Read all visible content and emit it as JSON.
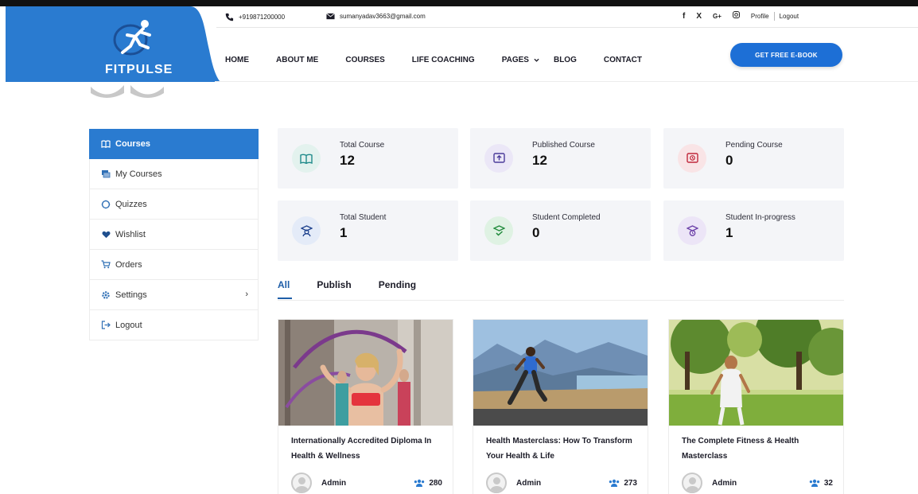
{
  "brand": {
    "name": "FITPULSE",
    "panel_color": "#2a7bd0"
  },
  "contact": {
    "phone": "+919871200000",
    "email": "sumanyadav3663@gmail.com"
  },
  "social": {
    "facebook": "f",
    "x": "X",
    "google": "G+",
    "profile": "Profile",
    "logout": "Logout"
  },
  "nav": {
    "items": [
      "HOME",
      "ABOUT ME",
      "COURSES",
      "LIFE COACHING",
      "PAGES",
      "BLOG",
      "CONTACT"
    ],
    "cta": "GET FREE E-BOOK"
  },
  "sidebar": {
    "items": [
      {
        "label": "Courses",
        "icon": "book-open-icon"
      },
      {
        "label": "My Courses",
        "icon": "courses-stack-icon"
      },
      {
        "label": "Quizzes",
        "icon": "quiz-icon"
      },
      {
        "label": "Wishlist",
        "icon": "heart-icon"
      },
      {
        "label": "Orders",
        "icon": "cart-icon"
      },
      {
        "label": "Settings",
        "icon": "gear-icon"
      },
      {
        "label": "Logout",
        "icon": "logout-icon"
      }
    ]
  },
  "stats": [
    {
      "label": "Total Course",
      "value": "12",
      "icon": "book-open-icon",
      "bg": "#e3f2ee"
    },
    {
      "label": "Published Course",
      "value": "12",
      "icon": "book-publish-icon",
      "bg": "#ebe7f7"
    },
    {
      "label": "Pending Course",
      "value": "0",
      "icon": "book-pending-icon",
      "bg": "#f9e4e6"
    },
    {
      "label": "Total Student",
      "value": "1",
      "icon": "student-icon",
      "bg": "#e4ebf8"
    },
    {
      "label": "Student Completed",
      "value": "0",
      "icon": "student-completed-icon",
      "bg": "#dff2e3"
    },
    {
      "label": "Student In-progress",
      "value": "1",
      "icon": "student-progress-icon",
      "bg": "#ece5f7"
    }
  ],
  "tabs": [
    "All",
    "Publish",
    "Pending"
  ],
  "courses": [
    {
      "title": "Internationally Accredited Diploma In Health & Wellness",
      "author": "Admin",
      "students": "280"
    },
    {
      "title": "Health Masterclass: How To Transform Your Health & Life",
      "author": "Admin",
      "students": "273"
    },
    {
      "title": "The Complete Fitness & Health Masterclass",
      "author": "Admin",
      "students": "32"
    }
  ]
}
